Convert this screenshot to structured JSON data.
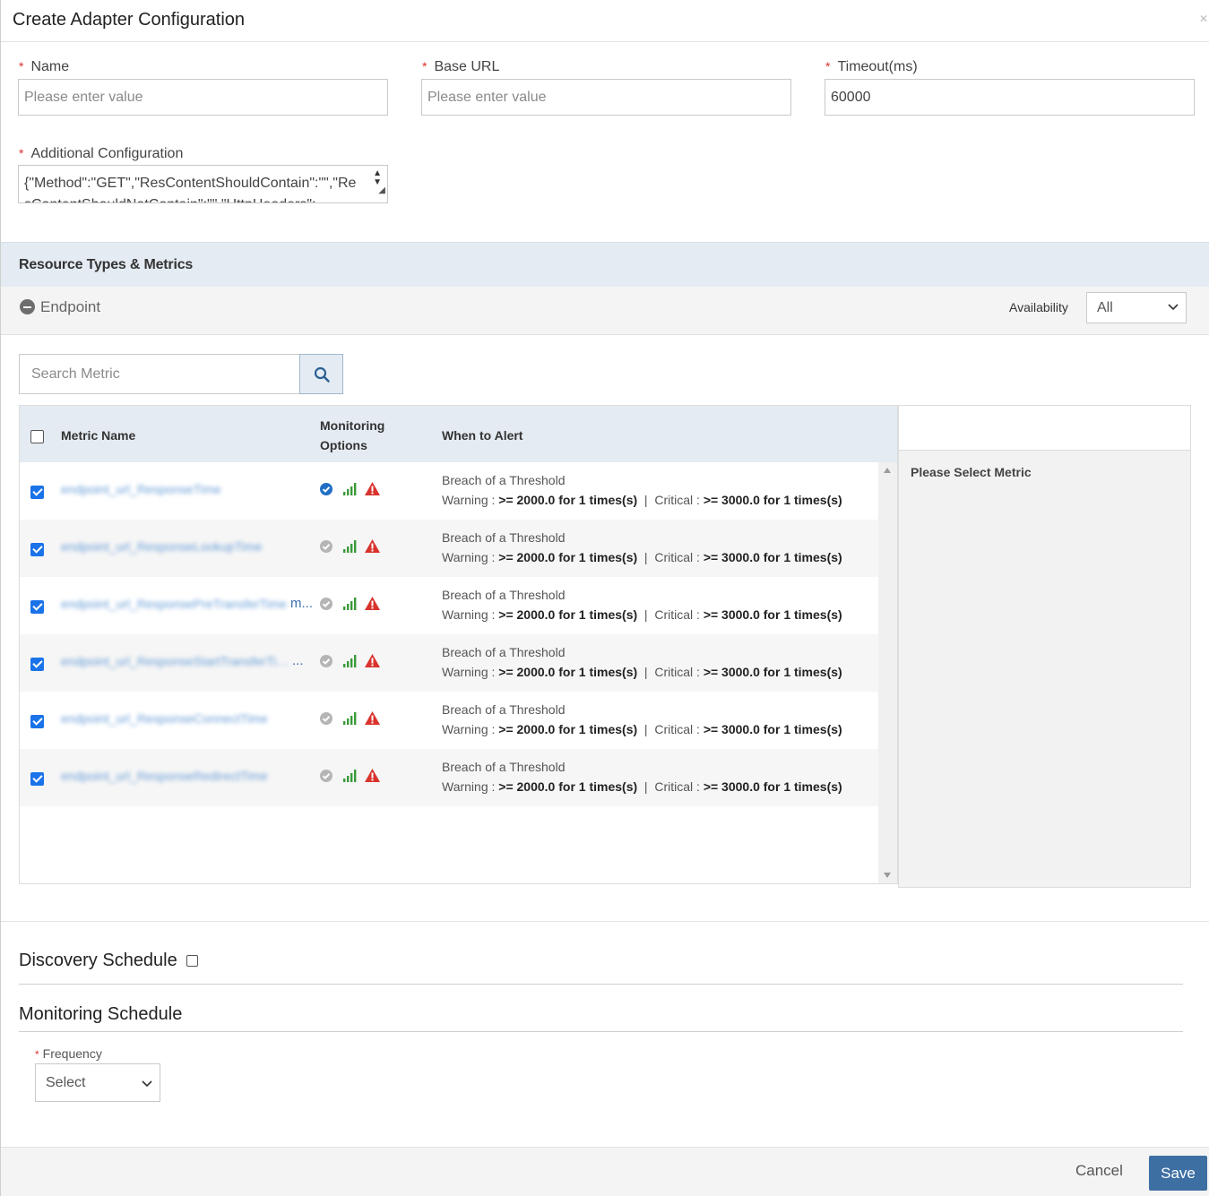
{
  "dialog": {
    "title": "Create Adapter Configuration"
  },
  "form": {
    "name": {
      "label": "Name",
      "placeholder": "Please enter value",
      "required": "*"
    },
    "base_url": {
      "label": "Base URL",
      "placeholder": "Please enter value",
      "required": "*"
    },
    "timeout": {
      "label": "Timeout(ms)",
      "value": "60000",
      "required": "*"
    },
    "additional": {
      "label": "Additional Configuration",
      "value": "{\"Method\":\"GET\",\"ResContentShouldContain\":\"\",\"ResContentShouldNotContain\":\"\",\"HttpHeaders\":",
      "required": "*"
    }
  },
  "resources": {
    "section_title": "Resource Types & Metrics",
    "endpoint_label": "Endpoint",
    "availability_label": "Availability",
    "availability_value": "All",
    "search_placeholder": "Search Metric",
    "columns": {
      "metric_name": "Metric Name",
      "monitoring_1": "Monitoring",
      "monitoring_2": "Options",
      "when_to_alert": "When to Alert"
    },
    "detail_message": "Please Select Metric",
    "rows": [
      {
        "name": "endpoint_url_ResponseTime",
        "checked": true,
        "primary": true,
        "alert_title": "Breach of a Threshold",
        "warning_label": "Warning : ",
        "warning_value": ">= 2000.0 for 1 times(s)",
        "critical_label": "  |  Critical : ",
        "critical_value": ">= 3000.0 for 1 times(s)"
      },
      {
        "name": "endpoint_url_ResponseLookupTime",
        "checked": true,
        "primary": false,
        "alert_title": "Breach of a Threshold",
        "warning_label": "Warning : ",
        "warning_value": ">= 2000.0 for 1 times(s)",
        "critical_label": "  |  Critical : ",
        "critical_value": ">= 3000.0 for 1 times(s)"
      },
      {
        "name": "endpoint_url_ResponsePreTransferTime",
        "ellipsis": "m...",
        "checked": true,
        "primary": false,
        "alert_title": "Breach of a Threshold",
        "warning_label": "Warning : ",
        "warning_value": ">= 2000.0 for 1 times(s)",
        "critical_label": "  |  Critical : ",
        "critical_value": ">= 3000.0 for 1 times(s)"
      },
      {
        "name": "endpoint_url_ResponseStartTransferTime",
        "ellipsis": "...",
        "checked": true,
        "primary": false,
        "alert_title": "Breach of a Threshold",
        "warning_label": "Warning : ",
        "warning_value": ">= 2000.0 for 1 times(s)",
        "critical_label": "  |  Critical : ",
        "critical_value": ">= 3000.0 for 1 times(s)"
      },
      {
        "name": "endpoint_url_ResponseConnectTime",
        "checked": true,
        "primary": false,
        "alert_title": "Breach of a Threshold",
        "warning_label": "Warning : ",
        "warning_value": ">= 2000.0 for 1 times(s)",
        "critical_label": "  |  Critical : ",
        "critical_value": ">= 3000.0 for 1 times(s)"
      },
      {
        "name": "endpoint_url_ResponseRedirectTime",
        "checked": true,
        "primary": false,
        "alert_title": "Breach of a Threshold",
        "warning_label": "Warning : ",
        "warning_value": ">= 2000.0 for 1 times(s)",
        "critical_label": "  |  Critical : ",
        "critical_value": ">= 3000.0 for 1 times(s)"
      }
    ]
  },
  "discovery": {
    "title": "Discovery Schedule"
  },
  "monitoring": {
    "title": "Monitoring Schedule",
    "frequency_label": "Frequency",
    "frequency_required": "*",
    "frequency_value": "Select"
  },
  "footer": {
    "cancel": "Cancel",
    "save": "Save"
  },
  "colors": {
    "accent": "#3e6fa3",
    "checkbox": "#1a73e8",
    "required": "#d9332d",
    "signal": "#3a9a3a",
    "warning": "#d9332d",
    "header_bg": "#e4ebf2"
  }
}
